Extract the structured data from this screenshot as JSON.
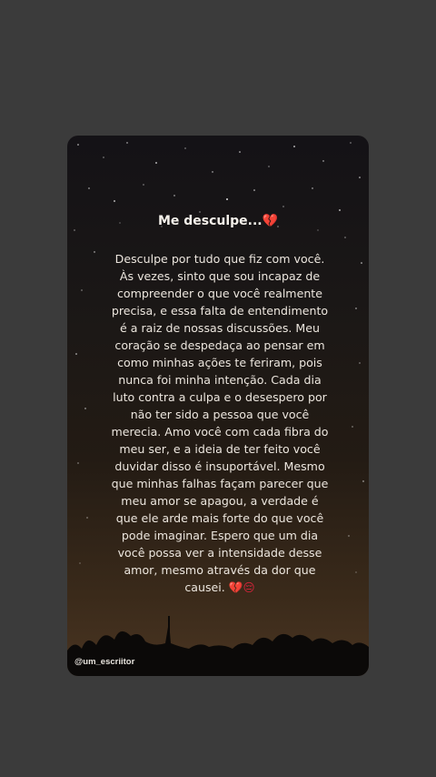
{
  "post": {
    "title": "Me desculpe...",
    "title_emoji": "💔",
    "body": "Desculpe por tudo que fiz com você. Às vezes, sinto que sou incapaz de compreender o que você realmente precisa, e essa falta de entendimento é a raiz de nossas discussões. Meu coração se despedaça ao pensar em como minhas ações te feriram, pois nunca foi minha intenção. Cada dia luto contra a culpa e o desespero por não ter sido a pessoa que você merecia. Amo você com cada fibra do meu ser, e a ideia de ter feito você duvidar disso é insuportável. Mesmo que minhas falhas façam parecer que meu amor se apagou, a verdade é que ele arde mais forte do que você pode imaginar. Espero que um dia você possa ver a intensidade desse amor, mesmo através da dor que causei.",
    "body_emoji": "💔😔",
    "handle": "@um_escriitor"
  },
  "colors": {
    "page_bg": "#3b3b3b",
    "card_sky_top": "#141216",
    "card_sky_bottom": "#4a3522",
    "text": "#ece6de",
    "heart": "#d1243a"
  }
}
